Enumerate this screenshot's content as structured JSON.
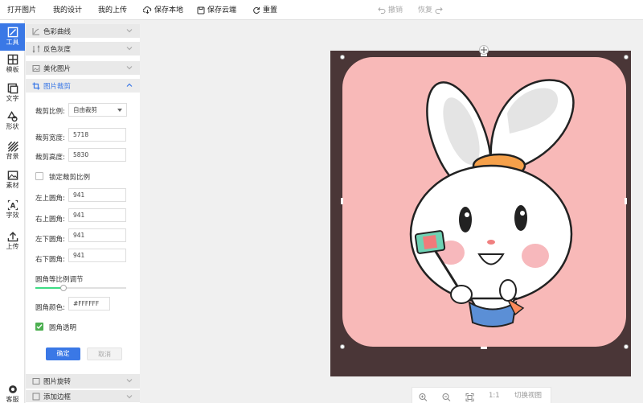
{
  "toolbar": {
    "open_image": "打开图片",
    "my_designs": "我的设计",
    "my_uploads": "我的上传",
    "save_local": "保存本地",
    "save_cloud": "保存云端",
    "reset": "重置",
    "undo": "撤销",
    "redo": "恢复"
  },
  "rail": {
    "items": [
      {
        "label": "工具",
        "icon": "crop-tool-icon"
      },
      {
        "label": "模板",
        "icon": "template-icon"
      },
      {
        "label": "文字",
        "icon": "text-icon"
      },
      {
        "label": "形状",
        "icon": "shape-icon"
      },
      {
        "label": "背景",
        "icon": "background-icon"
      },
      {
        "label": "素材",
        "icon": "image-icon"
      },
      {
        "label": "字效",
        "icon": "text-effect-icon"
      },
      {
        "label": "上传",
        "icon": "upload-icon"
      },
      {
        "label": "客服",
        "icon": "service-icon"
      }
    ]
  },
  "panel": {
    "sections": {
      "color_curve": "色彩曲线",
      "invert_gray": "反色灰度",
      "beautify": "美化图片",
      "crop": "图片裁剪",
      "rotate": "图片旋转",
      "border": "添加边框"
    },
    "crop": {
      "ratio_label": "裁剪比例:",
      "ratio_value": "自由裁剪",
      "width_label": "裁剪宽度:",
      "width_value": "5718",
      "height_label": "裁剪高度:",
      "height_value": "5830",
      "lock_label": "锁定裁剪比例",
      "tl_label": "左上圆角:",
      "tl_value": "941",
      "tr_label": "右上圆角:",
      "tr_value": "941",
      "bl_label": "左下圆角:",
      "bl_value": "941",
      "br_label": "右下圆角:",
      "br_value": "941",
      "slider_label": "圆角等比例调节",
      "color_label": "圆角颜色:",
      "color_value": "#FFFFFF",
      "transparent_label": "圆角透明",
      "confirm": "确定",
      "cancel": "取消"
    }
  },
  "viewbar": {
    "ratio": "1:1",
    "switch_view": "切换视图"
  },
  "colors": {
    "accent": "#3a78e6",
    "canvas_bg": "#4a3637",
    "image_bg": "#f8b9b8",
    "check": "#4caf50"
  }
}
